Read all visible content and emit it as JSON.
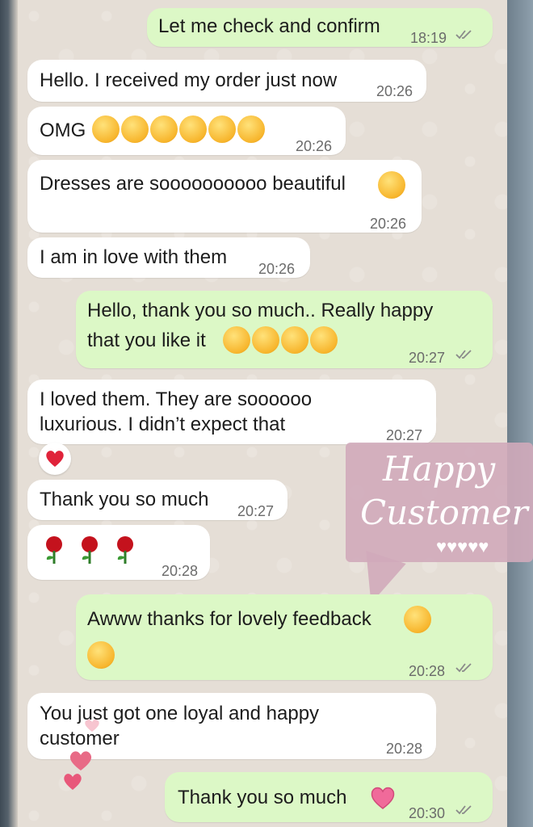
{
  "messages": [
    {
      "text": "Let me check and confirm",
      "time": "18:19"
    },
    {
      "text": "Hello. I received my order just now",
      "time": "20:26"
    },
    {
      "text": "OMG",
      "time": "20:26"
    },
    {
      "text": "Dresses are soooooooooo beautiful",
      "time": "20:26"
    },
    {
      "text": "I am in love with them",
      "time": "20:26"
    },
    {
      "line1": "Hello, thank you so much.. Really happy",
      "line2": "that you like it",
      "time": "20:27"
    },
    {
      "line1": "I loved them. They are soooooo",
      "line2": "luxurious. I didn’t expect that",
      "time": "20:27"
    },
    {
      "text": "Thank you so much",
      "time": "20:27"
    },
    {
      "time": "20:28"
    },
    {
      "text": "Awww thanks for lovely feedback",
      "time": "20:28"
    },
    {
      "line1": "You just got one loyal and happy",
      "line2": "customer",
      "time": "20:28"
    },
    {
      "text": "Thank you so much",
      "time": "20:30"
    }
  ],
  "sticker": {
    "line1": "Happy",
    "line2": "Customer",
    "hearts": "♥♥♥♥♥"
  },
  "icons": [
    "double-check-icon",
    "astonished-face-emoji",
    "star-struck-emoji",
    "smiling-face-emoji",
    "grinning-face-emoji",
    "rose-emoji",
    "red-heart-reaction",
    "pink-heart-emoji",
    "floating-hearts-icon"
  ],
  "colors": {
    "incoming": "#ffffff",
    "outgoing": "#dcf8c6",
    "chat_background": "#e5ded6",
    "sticker": "#d0aaba",
    "tick": "#8a8a8a"
  }
}
